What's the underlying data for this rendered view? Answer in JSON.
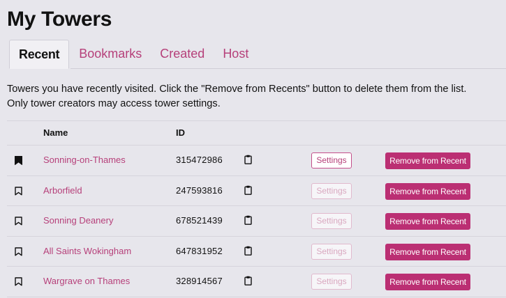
{
  "page_title": "My Towers",
  "tabs": [
    {
      "label": "Recent",
      "active": true
    },
    {
      "label": "Bookmarks",
      "active": false
    },
    {
      "label": "Created",
      "active": false
    },
    {
      "label": "Host",
      "active": false
    }
  ],
  "intro": {
    "line1": "Towers you have recently visited. Click the \"Remove from Recents\" button to delete them from the list.",
    "line2": "Only tower creators may access tower settings."
  },
  "table": {
    "headers": {
      "name": "Name",
      "id": "ID"
    },
    "rows": [
      {
        "bookmarked": true,
        "name": "Sonning-on-Thames",
        "id": "315472986",
        "settings_label": "Settings",
        "settings_enabled": true,
        "remove_label": "Remove from Recent"
      },
      {
        "bookmarked": false,
        "name": "Arborfield",
        "id": "247593816",
        "settings_label": "Settings",
        "settings_enabled": false,
        "remove_label": "Remove from Recent"
      },
      {
        "bookmarked": false,
        "name": "Sonning Deanery",
        "id": "678521439",
        "settings_label": "Settings",
        "settings_enabled": false,
        "remove_label": "Remove from Recent"
      },
      {
        "bookmarked": false,
        "name": "All Saints Wokingham",
        "id": "647831952",
        "settings_label": "Settings",
        "settings_enabled": false,
        "remove_label": "Remove from Recent"
      },
      {
        "bookmarked": false,
        "name": "Wargrave on Thames",
        "id": "328914567",
        "settings_label": "Settings",
        "settings_enabled": false,
        "remove_label": "Remove from Recent"
      }
    ]
  },
  "icons": {
    "bookmark": "bookmark-icon",
    "copy": "clipboard-icon"
  },
  "colors": {
    "background": "#e7e6ec",
    "accent": "#b6407a",
    "remove_button": "#bb2f73",
    "text": "#111111"
  }
}
